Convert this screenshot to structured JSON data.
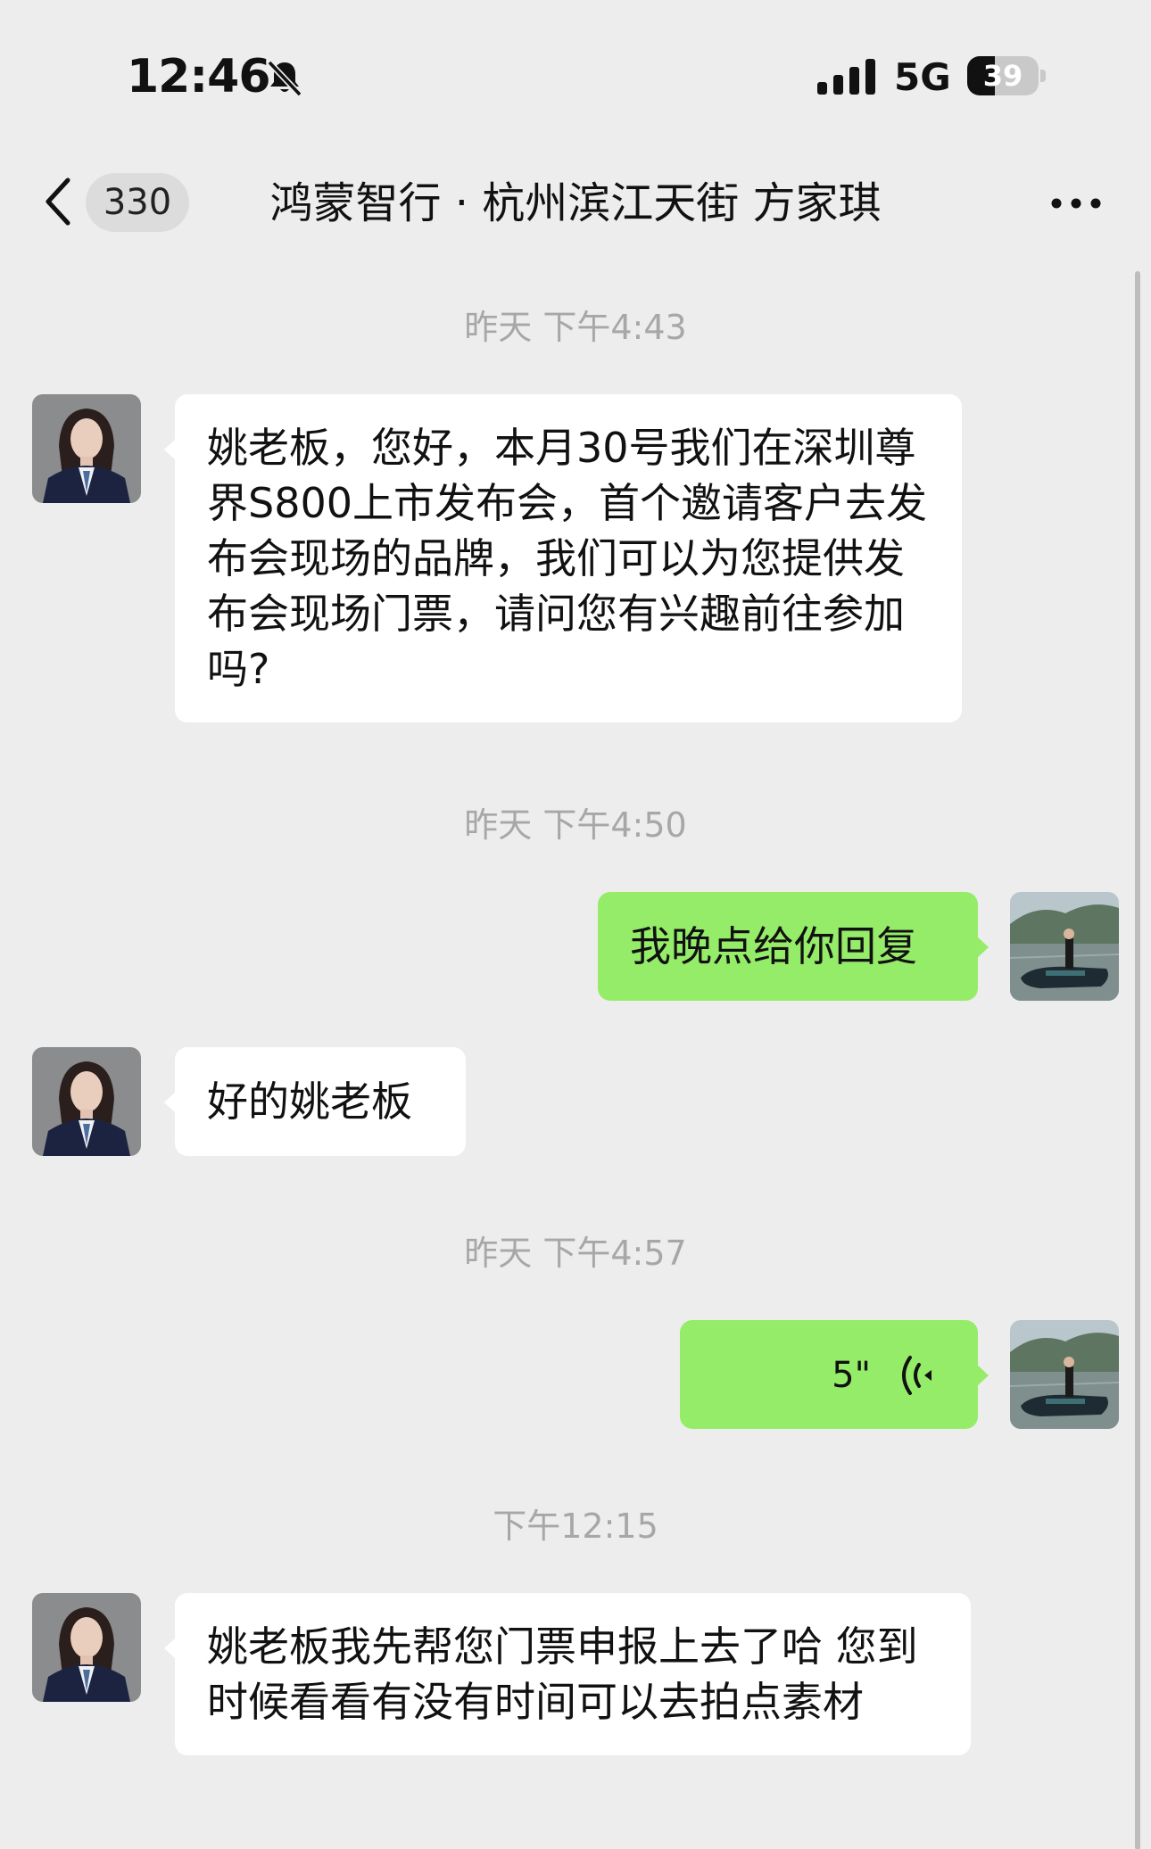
{
  "status_bar": {
    "time": "12:46",
    "mute_icon": "bell-slash-icon",
    "signal_icon": "cellular-signal-icon",
    "network": "5G",
    "battery_level": "39",
    "battery_fraction": 0.39
  },
  "nav": {
    "back_icon": "chevron-left-icon",
    "unread_count": "330",
    "title": "鸿蒙智行 · 杭州滨江天街 方家琪",
    "more_icon": "ellipsis-icon"
  },
  "colors": {
    "background": "#ededed",
    "incoming_bubble": "#ffffff",
    "outgoing_bubble": "#95ec69",
    "timestamp": "#a7a7a7"
  },
  "messages": [
    {
      "type": "timestamp",
      "text": "昨天 下午4:43"
    },
    {
      "type": "incoming",
      "text": "姚老板，您好，本月30号我们在深圳尊界S800上市发布会，首个邀请客户去发布会现场的品牌，我们可以为您提供发布会现场门票，请问您有兴趣前往参加吗?"
    },
    {
      "type": "timestamp",
      "text": "昨天 下午4:50"
    },
    {
      "type": "outgoing",
      "text": "我晚点给你回复"
    },
    {
      "type": "incoming",
      "text": "好的姚老板"
    },
    {
      "type": "timestamp",
      "text": "昨天 下午4:57"
    },
    {
      "type": "outgoing-voice",
      "duration": "5\"",
      "icon": "voice-wave-icon"
    },
    {
      "type": "timestamp",
      "text": "下午12:15"
    },
    {
      "type": "incoming",
      "text": "姚老板我先帮您门票申报上去了哈 您到时候看看有没有时间可以去拍点素材"
    }
  ]
}
